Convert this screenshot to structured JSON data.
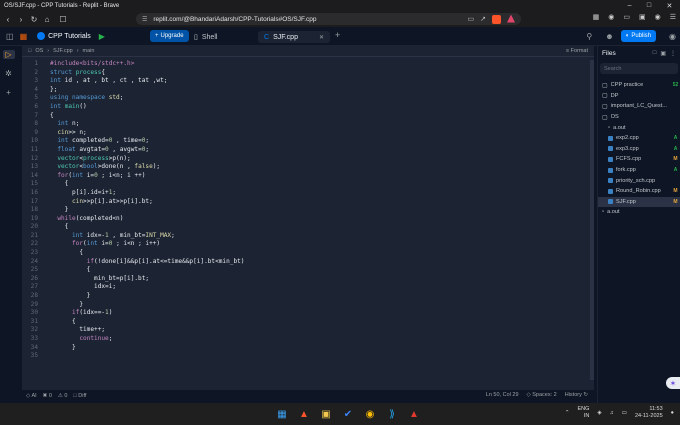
{
  "window": {
    "title": "OS/SJF.cpp - CPP Tutorials - Replit - Brave"
  },
  "browser": {
    "url": "replit.com/@BhandariAdarsh/CPP-Tutorials#OS/SJF.cpp"
  },
  "topbar": {
    "repo_name": "CPP Tutorials",
    "upgrade_label": "Upgrade",
    "publish_label": "Publish"
  },
  "tabs": [
    {
      "label": "Shell",
      "icon": "shell-icon"
    },
    {
      "label": "SJF.cpp",
      "icon": "file-icon"
    }
  ],
  "editor": {
    "breadcrumbs": [
      "OS",
      "SJF.cpp",
      "main"
    ],
    "format_label": "Format",
    "lines": [
      {
        "n": "1",
        "t": "#include<bits/stdc++.h>"
      },
      {
        "n": "2",
        "t": "struct process{"
      },
      {
        "n": "3",
        "t": "int id , at , bt , ct , tat ,wt;"
      },
      {
        "n": "4",
        "t": "};"
      },
      {
        "n": "5",
        "t": "using namespace std;"
      },
      {
        "n": "6",
        "t": "int main()"
      },
      {
        "n": "7",
        "t": "{"
      },
      {
        "n": "8",
        "t": "  int n;"
      },
      {
        "n": "9",
        "t": "  cin>> n;"
      },
      {
        "n": "10",
        "t": "  int completed=0 , time=0;"
      },
      {
        "n": "11",
        "t": "  float avgtat=0 , avgwt=0;"
      },
      {
        "n": "12",
        "t": "  vector<process>p(n);"
      },
      {
        "n": "13",
        "t": "  vector<bool>done(n , false);"
      },
      {
        "n": "14",
        "t": "  for(int i=0 ; i<n; i ++)"
      },
      {
        "n": "15",
        "t": "    {"
      },
      {
        "n": "16",
        "t": "      p[i].id=i+1;"
      },
      {
        "n": "17",
        "t": "      cin>>p[i].at>>p[i].bt;"
      },
      {
        "n": "18",
        "t": "    }"
      },
      {
        "n": "19",
        "t": "  while(completed<n)"
      },
      {
        "n": "20",
        "t": "    {"
      },
      {
        "n": "21",
        "t": "      int idx=-1 , min_bt=INT_MAX;"
      },
      {
        "n": "22",
        "t": "      for(int i=0 ; i<n ; i++)"
      },
      {
        "n": "23",
        "t": "        {"
      },
      {
        "n": "24",
        "t": "          if(!done[i]&&p[i].at<=time&&p[i].bt<min_bt)"
      },
      {
        "n": "25",
        "t": "          {"
      },
      {
        "n": "26",
        "t": "            min_bt=p[i].bt;"
      },
      {
        "n": "27",
        "t": "            idx=i;"
      },
      {
        "n": "28",
        "t": "          }"
      },
      {
        "n": "29",
        "t": "        }"
      },
      {
        "n": "30",
        "t": "      if(idx==-1)"
      },
      {
        "n": "31",
        "t": "      {"
      },
      {
        "n": "32",
        "t": "        time++;"
      },
      {
        "n": "33",
        "t": "        continue;"
      },
      {
        "n": "34",
        "t": "      }"
      },
      {
        "n": "35",
        "t": ""
      }
    ]
  },
  "statusbar": {
    "ai": "AI",
    "errors": "0",
    "warnings": "0",
    "diff": "Diff",
    "cursor": "Ln 50, Col 29",
    "spaces": "Spaces: 2",
    "history": "History"
  },
  "files_panel": {
    "title": "Files",
    "search_placeholder": "Search",
    "items": [
      {
        "name": "CPP practice",
        "type": "folder",
        "indent": 0,
        "badge": "52",
        "badge_color": "#28b24b"
      },
      {
        "name": "DP",
        "type": "folder",
        "indent": 0,
        "badge": "",
        "badge_color": ""
      },
      {
        "name": "important_LC_Quest...",
        "type": "folder",
        "indent": 0,
        "badge": "",
        "badge_color": ""
      },
      {
        "name": "OS",
        "type": "folder",
        "indent": 0,
        "badge": "",
        "badge_color": ""
      },
      {
        "name": "a.out",
        "type": "file",
        "indent": 1,
        "badge": "",
        "badge_color": ""
      },
      {
        "name": "exp2.cpp",
        "type": "cpp",
        "indent": 1,
        "badge": "A",
        "badge_color": "#28b24b"
      },
      {
        "name": "exp3.cpp",
        "type": "cpp",
        "indent": 1,
        "badge": "A",
        "badge_color": "#28b24b"
      },
      {
        "name": "FCFS.cpp",
        "type": "cpp",
        "indent": 1,
        "badge": "M",
        "badge_color": "#e5a53b"
      },
      {
        "name": "fork.cpp",
        "type": "cpp",
        "indent": 1,
        "badge": "A",
        "badge_color": "#28b24b"
      },
      {
        "name": "priority_sch.cpp",
        "type": "cpp",
        "indent": 1,
        "badge": "",
        "badge_color": ""
      },
      {
        "name": "Round_Robin.cpp",
        "type": "cpp",
        "indent": 1,
        "badge": "M",
        "badge_color": "#e5a53b"
      },
      {
        "name": "SJF.cpp",
        "type": "cpp",
        "indent": 1,
        "badge": "M",
        "badge_color": "#e5a53b"
      },
      {
        "name": "a.out",
        "type": "file",
        "indent": 0,
        "badge": "",
        "badge_color": ""
      }
    ]
  },
  "taskbar": {
    "lang": "ENG",
    "region": "IN",
    "time": "11:53",
    "date": "24-11-2025"
  }
}
